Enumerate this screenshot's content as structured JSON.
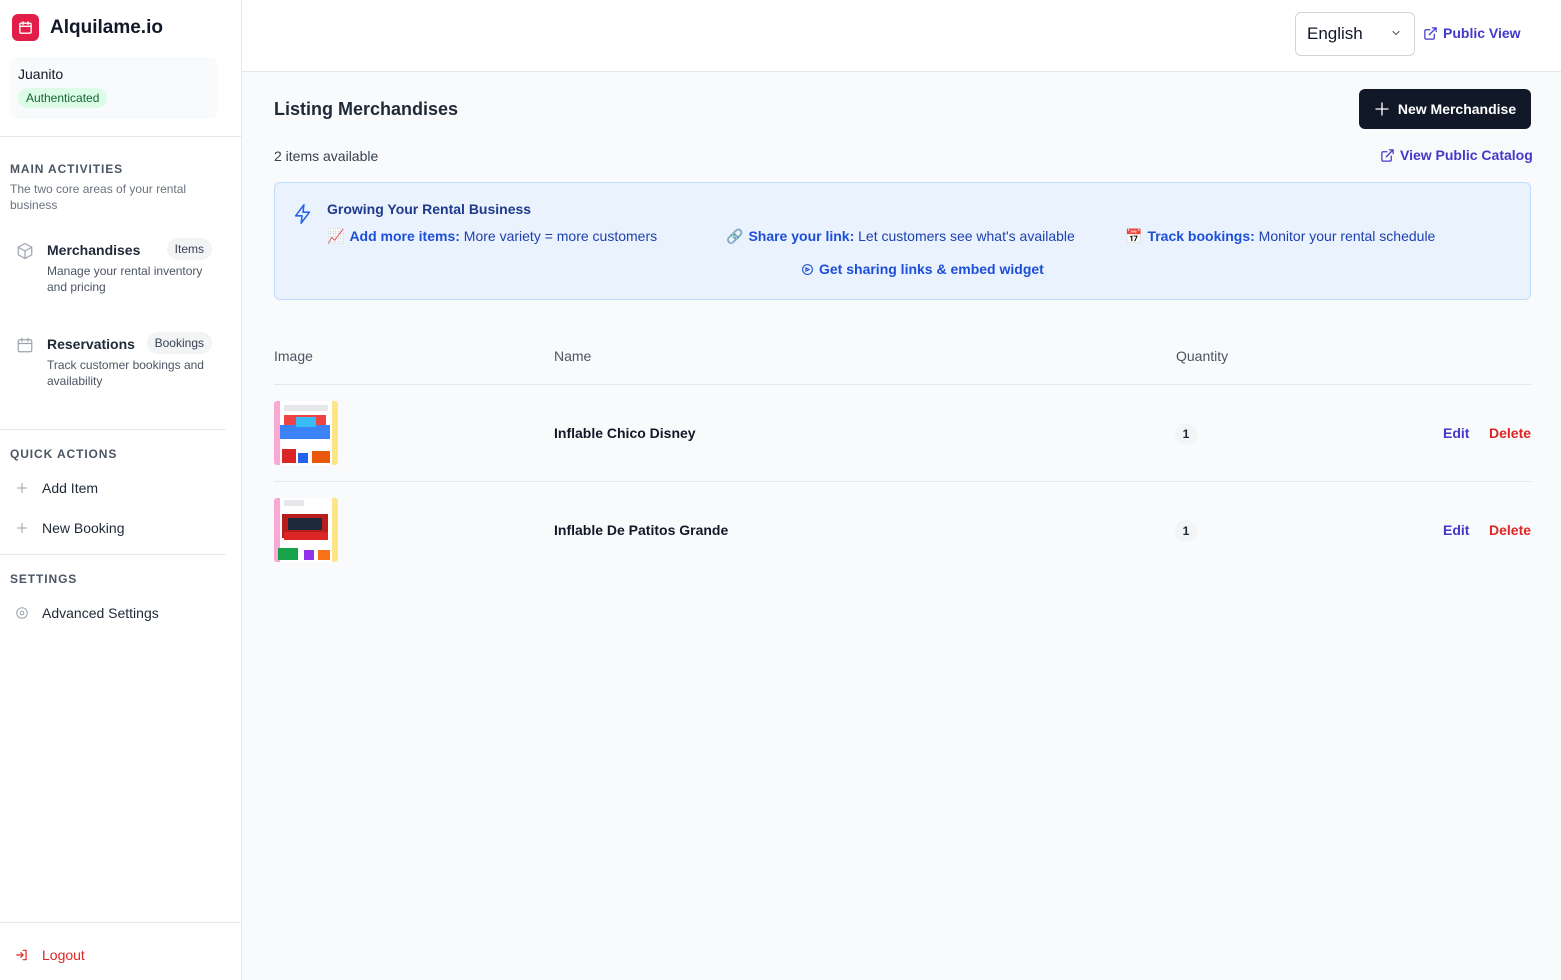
{
  "brand": {
    "name": "Alquilame.io",
    "color": "#e11d48"
  },
  "user": {
    "name": "Juanito",
    "status": "Authenticated"
  },
  "sidebar": {
    "main_title": "MAIN ACTIVITIES",
    "main_subtitle": "The two core areas of your rental business",
    "activities": [
      {
        "title": "Merchandises",
        "badge": "Items",
        "description": "Manage your rental inventory and pricing",
        "icon": "cube-icon"
      },
      {
        "title": "Reservations",
        "badge": "Bookings",
        "description": "Track customer bookings and availability",
        "icon": "calendar-icon"
      }
    ],
    "quick_title": "QUICK ACTIONS",
    "quick_actions": [
      {
        "label": "Add Item",
        "icon": "plus-icon"
      },
      {
        "label": "New Booking",
        "icon": "plus-icon"
      }
    ],
    "settings_title": "SETTINGS",
    "settings_item": "Advanced Settings",
    "logout": "Logout"
  },
  "topbar": {
    "language": "English",
    "public_view": "Public View"
  },
  "main": {
    "title": "Listing Merchandises",
    "new_button": "New Merchandise",
    "count": "2 items available",
    "catalog_link": "View Public Catalog",
    "tips": {
      "title": "Growing Your Rental Business",
      "items": [
        {
          "emoji": "📈",
          "label": "Add more items:",
          "text": " More variety = more customers"
        },
        {
          "emoji": "🔗",
          "label": "Share your link:",
          "text": " Let customers see what's available"
        },
        {
          "emoji": "📅",
          "label": "Track bookings:",
          "text": " Monitor your rental schedule"
        }
      ],
      "link": "Get sharing links & embed widget"
    },
    "table": {
      "columns": [
        "Image",
        "Name",
        "Quantity"
      ],
      "rows": [
        {
          "name": "Inflable Chico Disney",
          "quantity": "1",
          "edit": "Edit",
          "delete": "Delete"
        },
        {
          "name": "Inflable De Patitos Grande",
          "quantity": "1",
          "edit": "Edit",
          "delete": "Delete"
        }
      ]
    }
  }
}
